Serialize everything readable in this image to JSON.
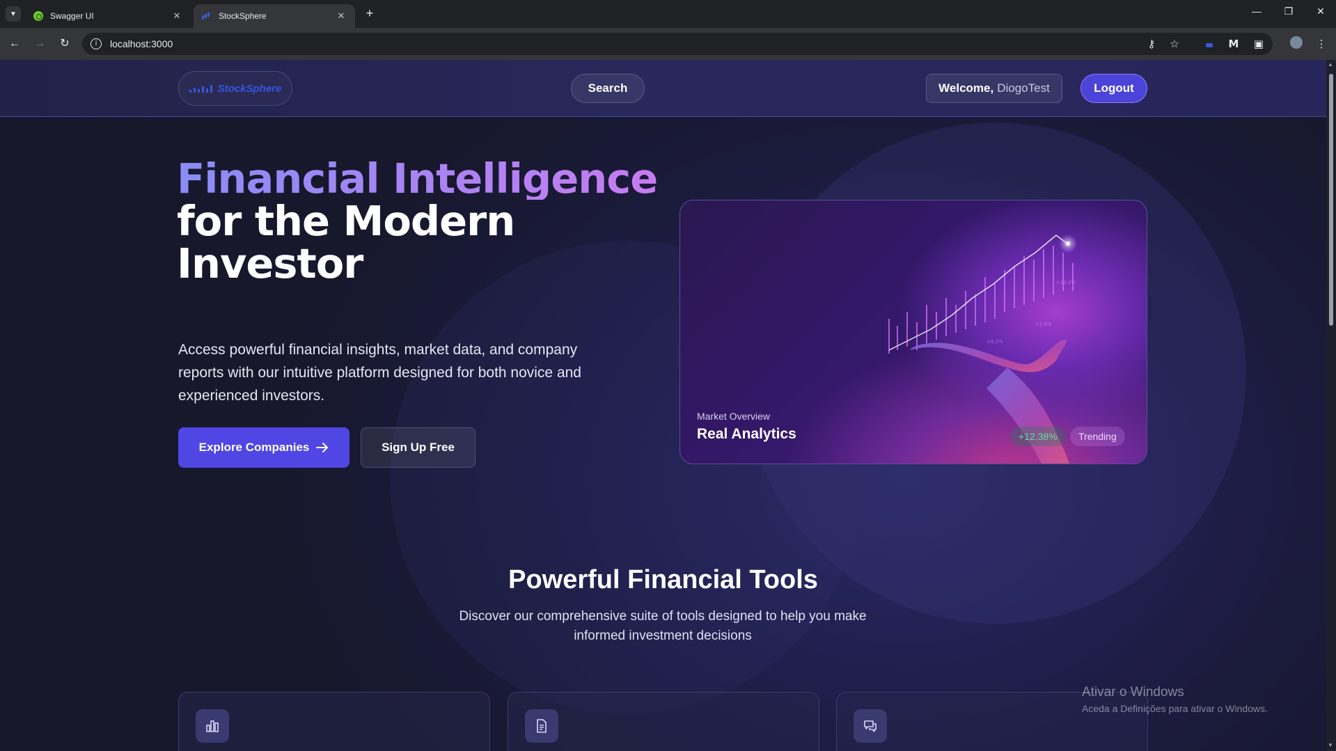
{
  "browser": {
    "tabs": [
      {
        "title": "Swagger UI",
        "favicon": "swagger-icon",
        "active": false
      },
      {
        "title": "StockSphere",
        "favicon": "stocksphere-icon",
        "active": true
      }
    ],
    "url": "localhost:3000"
  },
  "navbar": {
    "logo_text": "StockSphere",
    "search_label": "Search",
    "welcome_prefix": "Welcome,",
    "username": "DiogoTest",
    "logout_label": "Logout"
  },
  "hero": {
    "title_gradient": "Financial Intelligence",
    "title_line2": "for the Modern",
    "title_line3": "Investor",
    "subtitle": "Access powerful financial insights, market data, and company reports with our intuitive platform designed for both novice and experienced investors.",
    "explore_label": "Explore Companies",
    "signup_label": "Sign Up Free",
    "card": {
      "caption_small": "Market Overview",
      "caption_big": "Real Analytics",
      "change": "+12.38%",
      "tag": "Trending"
    }
  },
  "tools": {
    "title": "Powerful Financial Tools",
    "subtitle": "Discover our comprehensive suite of tools designed to help you make informed investment decisions",
    "cards": [
      {
        "icon": "bar-chart-icon"
      },
      {
        "icon": "document-icon"
      },
      {
        "icon": "chat-icon"
      }
    ]
  },
  "watermark": {
    "title": "Ativar o Windows",
    "subtitle": "Aceda a Definições para ativar o Windows."
  },
  "colors": {
    "accent": "#5046e4",
    "gradient_start": "#8a8cf6",
    "gradient_end": "#c67cf0",
    "positive": "#5ee0a0"
  }
}
